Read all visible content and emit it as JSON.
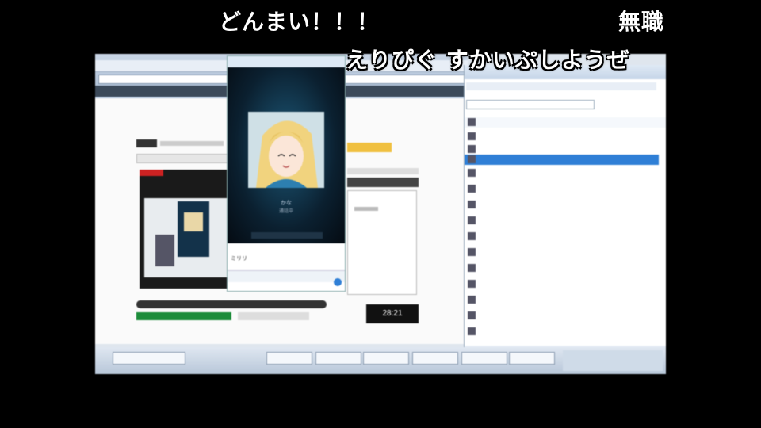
{
  "overlay_comments": {
    "comment1": "どんまい！！！",
    "comment2": "無職",
    "comment3": "えりぴぐ すかいぷしようぜ"
  },
  "video_call": {
    "caller_name": "かな",
    "call_status": "通話中",
    "message_preview": "ミリリ"
  },
  "clock": {
    "time": "28:21"
  },
  "colors": {
    "background": "#000000",
    "comment_text": "#ffffff",
    "skype_blue": "#2f7fd6"
  }
}
